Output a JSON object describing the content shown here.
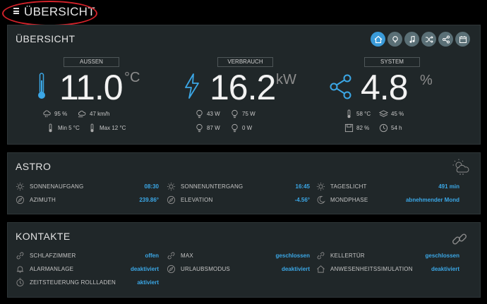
{
  "header": {
    "title": "ÜBERSICHT"
  },
  "overview": {
    "title": "ÜBERSICHT",
    "nav": [
      "home",
      "lightbulb",
      "music",
      "shuffle",
      "share",
      "calendar"
    ],
    "aussen": {
      "label": "AUSSEN",
      "value": "11.0",
      "unit": "°C",
      "humidity": "95 %",
      "wind": "47 km/h",
      "min": "Min 5 °C",
      "max": "Max 12 °C"
    },
    "verbrauch": {
      "label": "VERBRAUCH",
      "value": "16.2",
      "unit": "kW",
      "w1": "43 W",
      "w2": "75 W",
      "w3": "87 W",
      "w4": "0 W"
    },
    "system": {
      "label": "SYSTEM",
      "value": "4.8",
      "unit": "%",
      "temp": "58 °C",
      "load": "45 %",
      "disk": "82 %",
      "uptime": "54 h"
    }
  },
  "astro": {
    "title": "ASTRO",
    "sonnenaufgang_label": "SONNENAUFGANG",
    "sonnenaufgang_value": "08:30",
    "azimuth_label": "AZIMUTH",
    "azimuth_value": "239.86°",
    "sonnenuntergang_label": "SONNENUNTERGANG",
    "sonnenuntergang_value": "16:45",
    "elevation_label": "ELEVATION",
    "elevation_value": "-4.56°",
    "tageslicht_label": "TAGESLICHT",
    "tageslicht_value": "491 min",
    "mondphase_label": "MONDPHASE",
    "mondphase_value": "abnehmender Mond"
  },
  "kontakte": {
    "title": "KONTAKTE",
    "schlafzimmer_label": "SCHLAFZIMMER",
    "schlafzimmer_value": "offen",
    "alarmanlage_label": "ALARMANLAGE",
    "alarmanlage_value": "deaktiviert",
    "zeitsteuerung_label": "ZEITSTEUERUNG ROLLLADEN",
    "zeitsteuerung_value": "aktiviert",
    "max_label": "MAX",
    "max_value": "geschlossen",
    "urlaub_label": "URLAUBSMODUS",
    "urlaub_value": "deaktiviert",
    "keller_label": "KELLERTÜR",
    "keller_value": "geschlossen",
    "anwesenheit_label": "ANWESENHEITSSIMULATION",
    "anwesenheit_value": "deaktiviert"
  },
  "colors": {
    "accent": "#3ba7e6",
    "panel": "#202729",
    "background": "#000000",
    "highlight": "#d3222a"
  }
}
